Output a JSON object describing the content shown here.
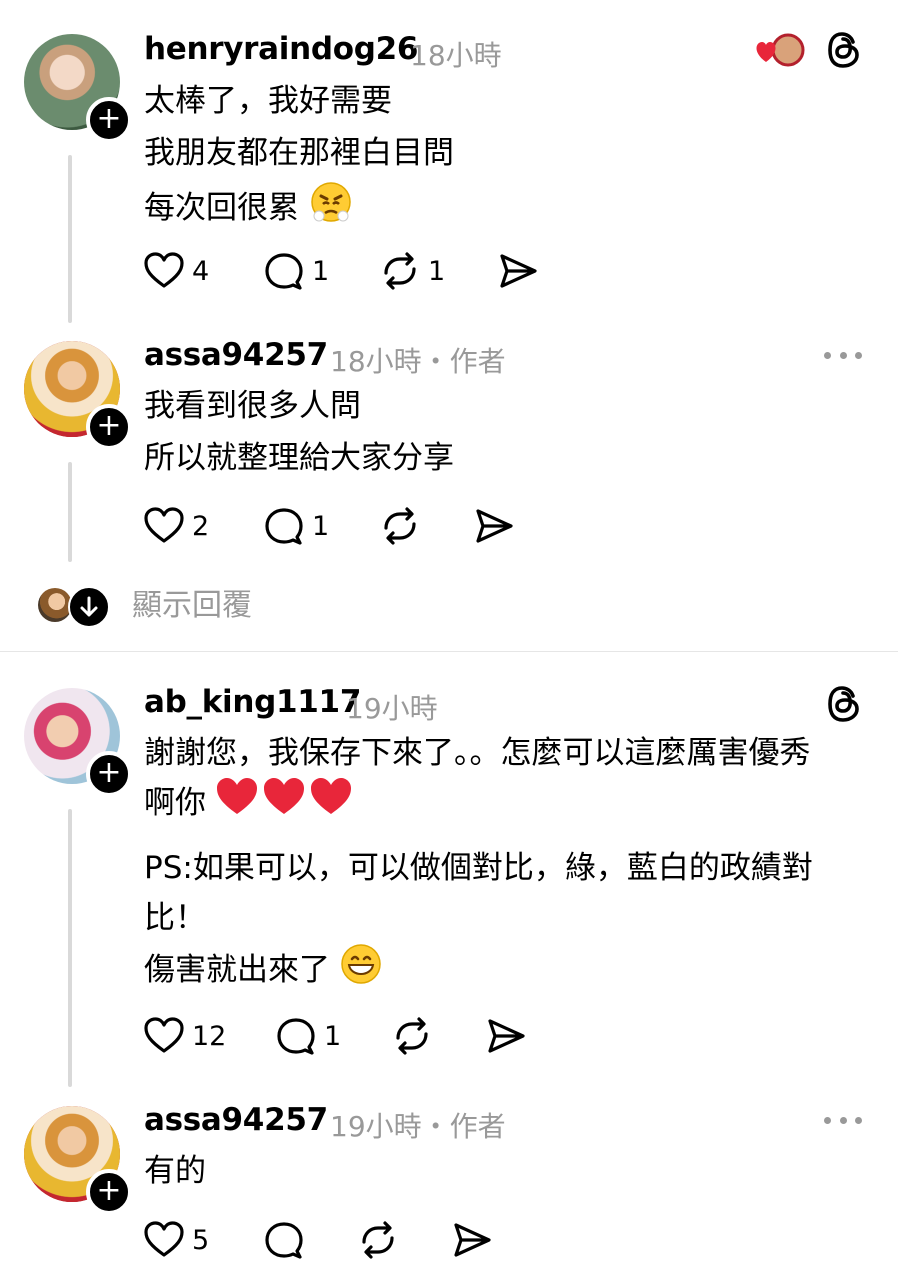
{
  "comments": [
    {
      "username": "henryraindog26",
      "time": "18小時",
      "lines": [
        "太棒了，我好需要",
        "我朋友都在那裡白目問",
        "每次回很累"
      ],
      "actions": {
        "likes": "4",
        "replies": "1",
        "reposts": "1"
      }
    },
    {
      "username": "assa94257",
      "time": "18小時・作者",
      "lines": [
        "我看到很多人問",
        "所以就整理給大家分享"
      ],
      "actions": {
        "likes": "2",
        "replies": "1"
      }
    },
    {
      "username": "ab_king1117",
      "time": "19小時",
      "lines": [
        "謝謝您，我保存下來了。。怎麼可以這麼厲害優秀",
        "啊你",
        "PS:如果可以，可以做個對比，綠，藍白的政績對",
        "比！",
        "傷害就出來了"
      ],
      "actions": {
        "likes": "12",
        "replies": "1"
      }
    },
    {
      "username": "assa94257",
      "time": "19小時・作者",
      "lines": [
        "有的"
      ],
      "actions": {
        "likes": "5"
      }
    }
  ],
  "show_replies": "顯示回覆",
  "colors": {
    "heart_red": "#e8263a",
    "ring_red": "#b3202c",
    "muted": "#999999"
  },
  "icons": [
    "heart-icon",
    "comment-icon",
    "repost-icon",
    "share-icon",
    "threads-logo-icon",
    "more-icon",
    "plus-icon",
    "arrow-down-icon"
  ]
}
